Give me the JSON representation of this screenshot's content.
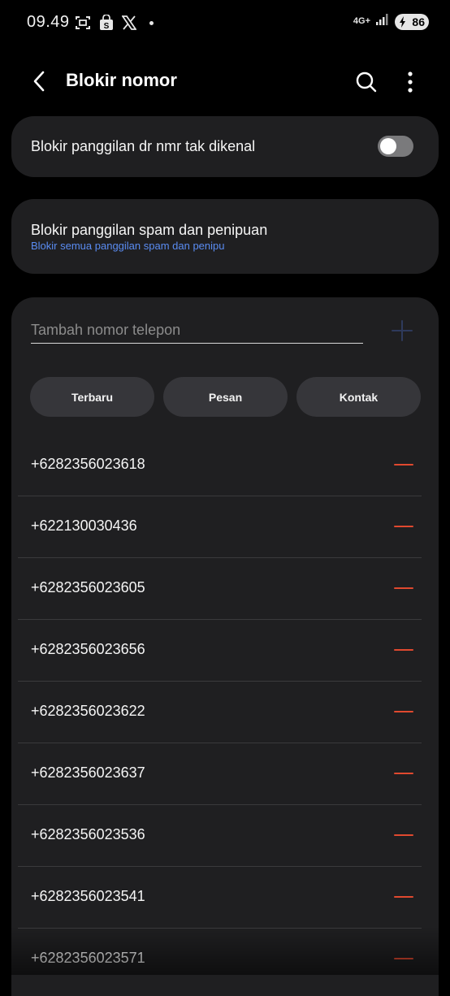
{
  "status_bar": {
    "time": "09.49",
    "network_label": "4G+",
    "battery_level": "86",
    "icons": [
      "screenshot-icon",
      "shop-icon",
      "x-icon",
      "notification-dot",
      "signal-icon",
      "battery-icon"
    ]
  },
  "header": {
    "title": "Blokir nomor",
    "icons": [
      "back-arrow-icon",
      "search-icon",
      "more-vertical-icon"
    ]
  },
  "block_unknown": {
    "label": "Blokir panggilan dr nmr tak dikenal",
    "toggle_on": false
  },
  "block_spam": {
    "title": "Blokir panggilan spam dan penipuan",
    "subtitle": "Blokir semua panggilan spam dan penipu"
  },
  "add_number": {
    "placeholder": "Tambah nomor telepon",
    "value": ""
  },
  "chips": [
    {
      "label": "Terbaru"
    },
    {
      "label": "Pesan"
    },
    {
      "label": "Kontak"
    }
  ],
  "blocked_numbers": [
    "+6282356023618",
    "+622130030436",
    "+6282356023605",
    "+6282356023656",
    "+6282356023622",
    "+6282356023637",
    "+6282356023536",
    "+6282356023541",
    "+6282356023571"
  ],
  "colors": {
    "background": "#000000",
    "card": "#1f1f21",
    "chip": "#36363a",
    "accent_blue": "#5a8cf2",
    "remove_red": "#e0492f",
    "toggle_off": "#7a7a7c"
  }
}
